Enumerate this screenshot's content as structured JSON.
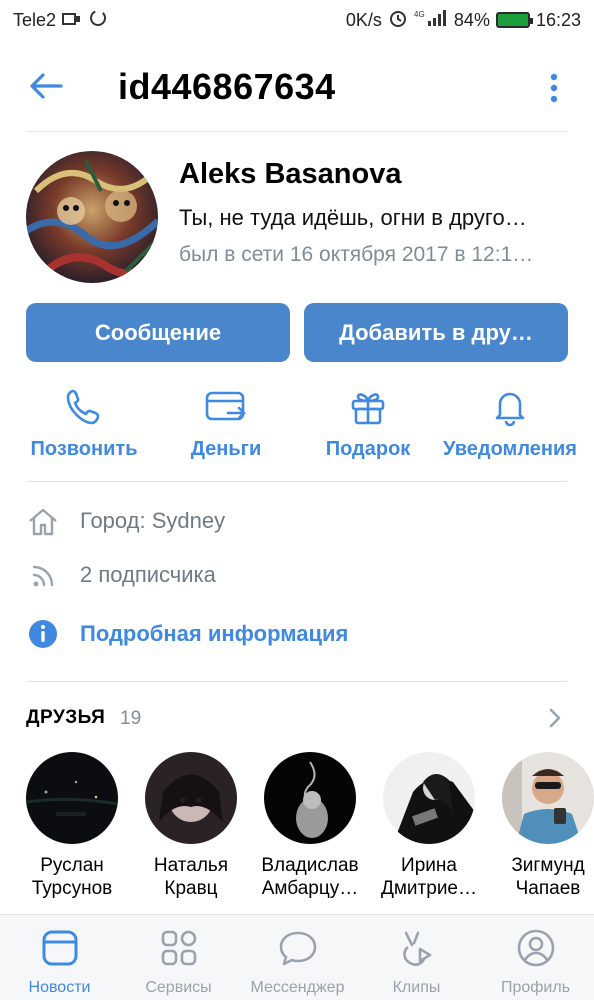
{
  "status_bar": {
    "carrier": "Tele2",
    "speed": "0K/s",
    "battery": "84%",
    "time": "16:23",
    "network": "4G"
  },
  "header": {
    "title": "id446867634",
    "back_icon": "arrow-left-icon",
    "more_icon": "more-vertical-icon"
  },
  "profile": {
    "name": "Aleks Basanova",
    "status": "Ты, не туда идёшь, огни в друго…",
    "last_seen": "был в сети 16 октября 2017 в 12:1…"
  },
  "buttons": {
    "message": "Сообщение",
    "add_friend": "Добавить в дру…"
  },
  "actions": [
    {
      "label": "Позвонить",
      "icon": "phone-icon"
    },
    {
      "label": "Деньги",
      "icon": "money-transfer-icon"
    },
    {
      "label": "Подарок",
      "icon": "gift-icon"
    },
    {
      "label": "Уведомления",
      "icon": "bell-icon"
    }
  ],
  "info": {
    "city": "Город: Sydney",
    "followers": "2 подписчика",
    "details": "Подробная информация"
  },
  "friends": {
    "title": "ДРУЗЬЯ",
    "count": "19",
    "items": [
      {
        "line1": "Руслан",
        "line2": "Турсунов"
      },
      {
        "line1": "Наталья",
        "line2": "Кравц"
      },
      {
        "line1": "Владислав",
        "line2": "Амбарцу…"
      },
      {
        "line1": "Ирина",
        "line2": "Дмитрие…"
      },
      {
        "line1": "Зигмунд",
        "line2": "Чапаев"
      }
    ]
  },
  "tabs": [
    {
      "label": "Новости",
      "icon": "news-icon",
      "active": true
    },
    {
      "label": "Сервисы",
      "icon": "services-icon",
      "active": false
    },
    {
      "label": "Мессенджер",
      "icon": "messenger-icon",
      "active": false
    },
    {
      "label": "Клипы",
      "icon": "clips-icon",
      "active": false
    },
    {
      "label": "Профиль",
      "icon": "profile-icon",
      "active": false
    }
  ],
  "colors": {
    "accent": "#3f8ae0",
    "button": "#4986cc",
    "secondary_text": "#818c99",
    "battery_fill": "#1b9e3e"
  }
}
